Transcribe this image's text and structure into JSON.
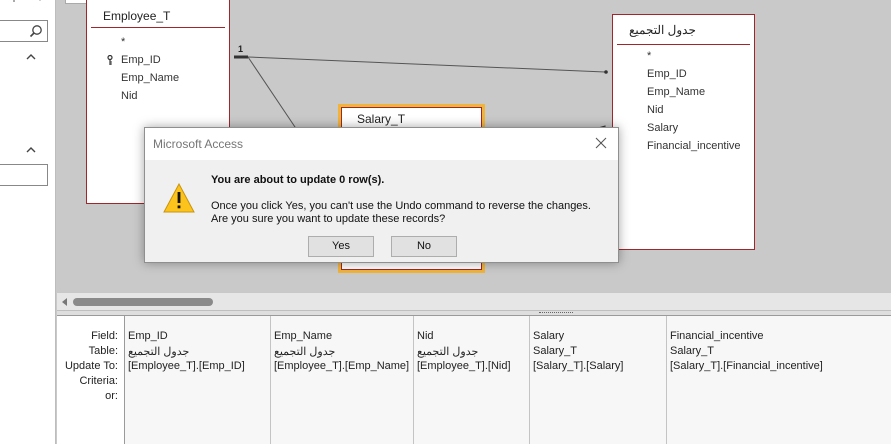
{
  "icons": {
    "search": "search-icon",
    "collapse": "chevron-up-icon",
    "key": "primary-key-icon",
    "warning": "warning-icon",
    "close": "close-icon"
  },
  "colors": {
    "table_border": "#a1262c",
    "highlight_border": "#f1b43a",
    "dialog_bg": "#f0f0f0"
  },
  "tables": {
    "employee": {
      "title": "Employee_T",
      "fields": [
        "*",
        "Emp_ID",
        "Emp_Name",
        "Nid"
      ]
    },
    "salary": {
      "title": "Salary_T"
    },
    "aggregate": {
      "title": "جدول التجميع",
      "fields": [
        "*",
        "Emp_ID",
        "Emp_Name",
        "Nid",
        "Salary",
        "Financial_incentive"
      ]
    }
  },
  "relationship": {
    "one_label": "1"
  },
  "grid": {
    "row_labels": [
      "Field:",
      "Table:",
      "Update To:",
      "Criteria:",
      "or:"
    ],
    "columns": [
      {
        "field": "Emp_ID",
        "table": "جدول التجميع",
        "update_to": "[Employee_T].[Emp_ID]"
      },
      {
        "field": "Emp_Name",
        "table": "جدول التجميع",
        "update_to": "[Employee_T].[Emp_Name]"
      },
      {
        "field": "Nid",
        "table": "جدول التجميع",
        "update_to": "[Employee_T].[Nid]"
      },
      {
        "field": "Salary",
        "table": "Salary_T",
        "update_to": "[Salary_T].[Salary]"
      },
      {
        "field": "Financial_incentive",
        "table": "Salary_T",
        "update_to": "[Salary_T].[Financial_incentive]"
      }
    ]
  },
  "dialog": {
    "title": "Microsoft Access",
    "heading": "You are about to update 0 row(s).",
    "line1": "Once you click Yes, you can't use the Undo command to reverse the changes.",
    "line2": "Are you sure you want to update these records?",
    "yes_label": "Yes",
    "no_label": "No"
  }
}
